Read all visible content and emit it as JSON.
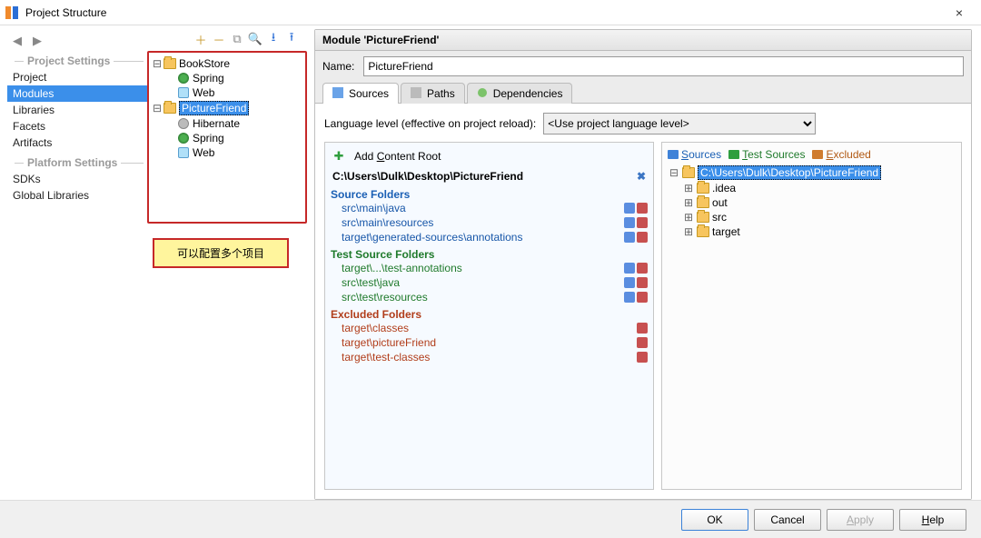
{
  "window": {
    "title": "Project Structure"
  },
  "sidebar": {
    "groups": [
      {
        "label": "Project Settings",
        "items": [
          "Project",
          "Modules",
          "Libraries",
          "Facets",
          "Artifacts"
        ],
        "selected_index": 1
      },
      {
        "label": "Platform Settings",
        "items": [
          "SDKs",
          "Global Libraries"
        ],
        "selected_index": -1
      }
    ]
  },
  "tree": {
    "modules": [
      {
        "name": "BookStore",
        "children": [
          {
            "name": "Spring",
            "icon": "spring"
          },
          {
            "name": "Web",
            "icon": "web"
          }
        ]
      },
      {
        "name": "PictureFriend",
        "selected": true,
        "children": [
          {
            "name": "Hibernate",
            "icon": "hibernate"
          },
          {
            "name": "Spring",
            "icon": "spring"
          },
          {
            "name": "Web",
            "icon": "web"
          }
        ]
      }
    ],
    "annotation": "可以配置多个项目"
  },
  "module": {
    "header": "Module 'PictureFriend'",
    "name_label": "Name:",
    "name_value": "PictureFriend",
    "tabs": [
      "Sources",
      "Paths",
      "Dependencies"
    ],
    "active_tab": 0,
    "language_level_label": "Language level (effective on project reload):",
    "language_level_value": "<Use project language level>",
    "add_content_root": "Add Content Root",
    "content_root_path": "C:\\Users\\Dulk\\Desktop\\PictureFriend",
    "marks": {
      "sources": "Sources",
      "tests": "Test Sources",
      "excluded": "Excluded"
    },
    "folders": {
      "source_title": "Source Folders",
      "source": [
        "src\\main\\java",
        "src\\main\\resources",
        "target\\generated-sources\\annotations"
      ],
      "test_title": "Test Source Folders",
      "test": [
        "target\\...\\test-annotations",
        "src\\test\\java",
        "src\\test\\resources"
      ],
      "excluded_title": "Excluded Folders",
      "excluded": [
        "target\\classes",
        "target\\pictureFriend",
        "target\\test-classes"
      ]
    },
    "filetree": {
      "root": "C:\\Users\\Dulk\\Desktop\\PictureFriend",
      "children": [
        ".idea",
        "out",
        "src",
        "target"
      ]
    }
  },
  "buttons": {
    "ok": "OK",
    "cancel": "Cancel",
    "apply": "Apply",
    "help": "Help"
  }
}
